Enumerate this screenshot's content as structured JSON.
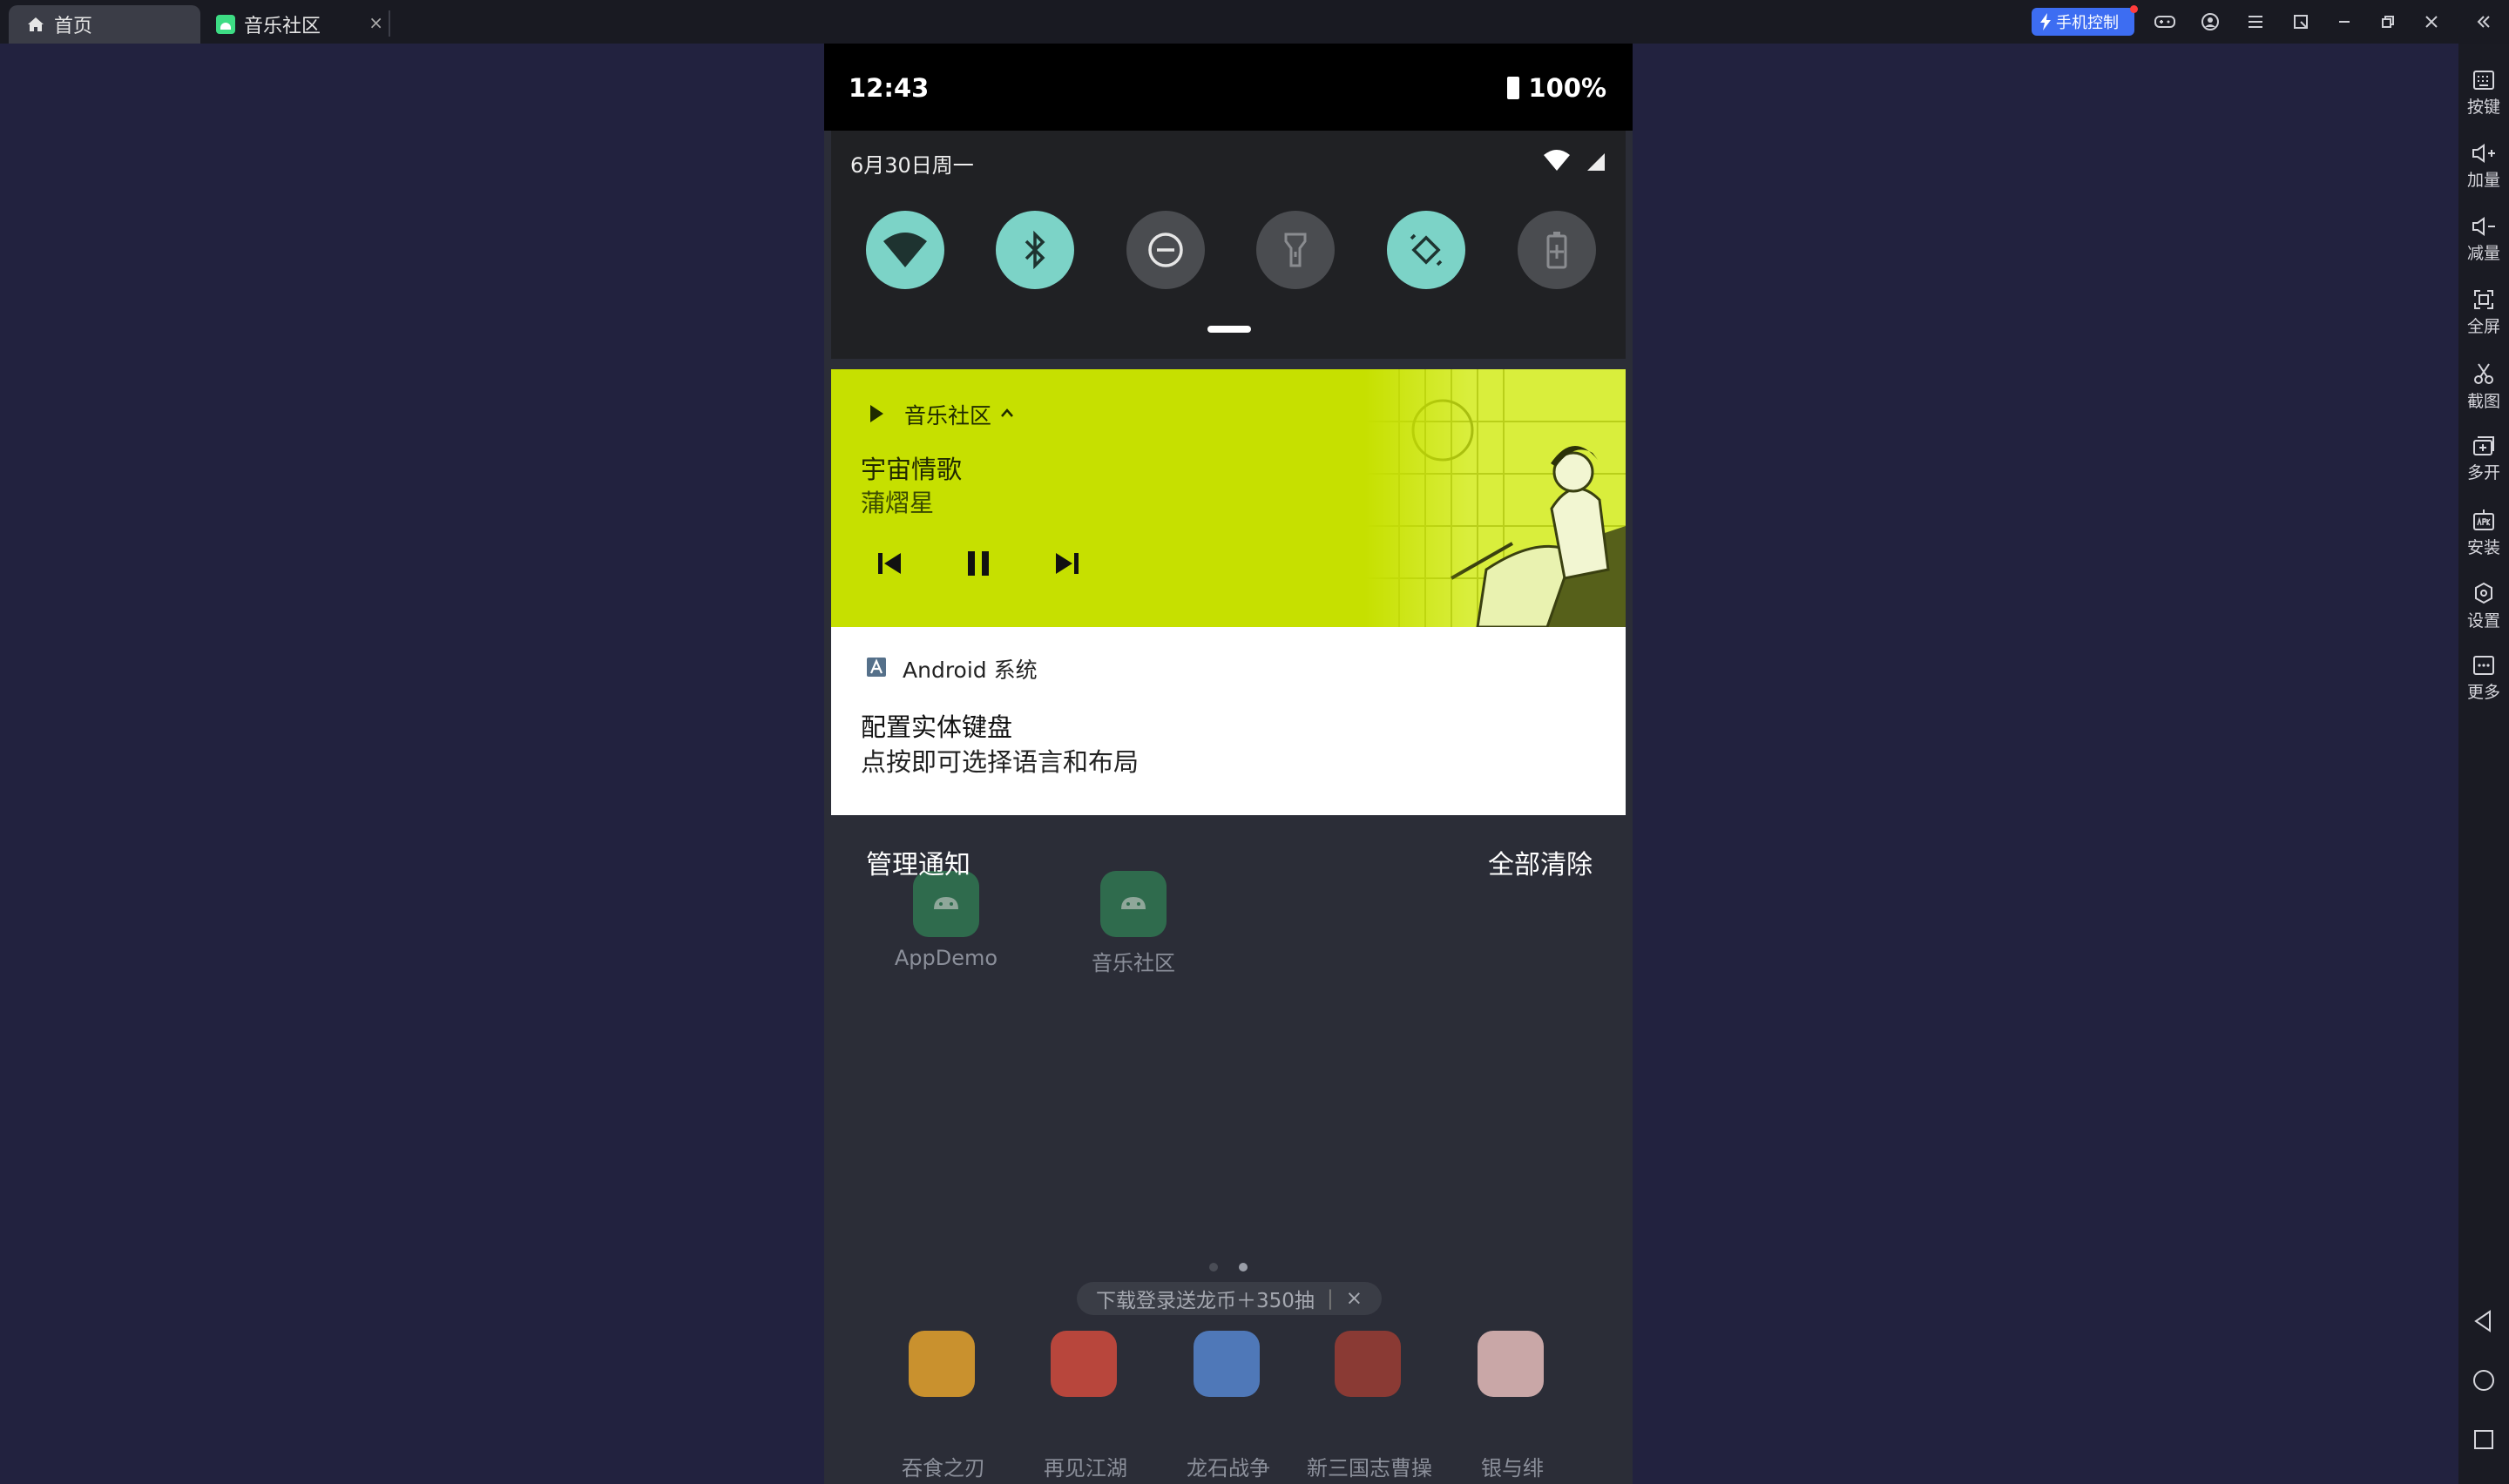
{
  "titlebar": {
    "tabs": [
      {
        "label": "首页",
        "icon": "home-icon"
      },
      {
        "label": "音乐社区",
        "icon": "android-app-icon"
      }
    ],
    "tab_close": "×",
    "phone_control": "手机控制"
  },
  "sidebar": {
    "items": [
      {
        "label": "按键",
        "icon": "keyboard-icon"
      },
      {
        "label": "加量",
        "icon": "volume-up-icon"
      },
      {
        "label": "减量",
        "icon": "volume-down-icon"
      },
      {
        "label": "全屏",
        "icon": "fullscreen-icon"
      },
      {
        "label": "截图",
        "icon": "scissors-icon"
      },
      {
        "label": "多开",
        "icon": "multi-instance-icon"
      },
      {
        "label": "安装",
        "icon": "apk-install-icon"
      },
      {
        "label": "设置",
        "icon": "settings-icon"
      },
      {
        "label": "更多",
        "icon": "more-icon"
      }
    ]
  },
  "status_bar": {
    "time": "12:43",
    "battery": "100%"
  },
  "quick_settings": {
    "date": "6月30日周一",
    "tiles": [
      {
        "name": "wifi",
        "active": true
      },
      {
        "name": "bluetooth",
        "active": true
      },
      {
        "name": "do-not-disturb",
        "active": false
      },
      {
        "name": "flashlight",
        "active": false
      },
      {
        "name": "auto-rotate",
        "active": true
      },
      {
        "name": "battery-saver",
        "active": false
      }
    ]
  },
  "media_notification": {
    "app": "音乐社区",
    "title": "宇宙情歌",
    "artist": "蒲熠星",
    "background": "#c6e000"
  },
  "system_notification": {
    "app": "Android 系统",
    "title": "配置实体键盘",
    "text": "点按即可选择语言和布局"
  },
  "shade_actions": {
    "manage": "管理通知",
    "clear_all": "全部清除"
  },
  "home": {
    "top_apps": [
      {
        "label": "AppDemo"
      },
      {
        "label": "音乐社区"
      }
    ],
    "promo": "下载登录送龙币＋350抽",
    "promo_close": "×",
    "dock": [
      {
        "label": "吞食之刃",
        "color": "#c9912e"
      },
      {
        "label": "再见江湖",
        "color": "#b8463c"
      },
      {
        "label": "龙石战争",
        "color": "#4f78b8"
      },
      {
        "label": "新三国志曹操",
        "color": "#8a3a34"
      },
      {
        "label": "银与绯",
        "color": "#c9a7a7"
      }
    ]
  }
}
